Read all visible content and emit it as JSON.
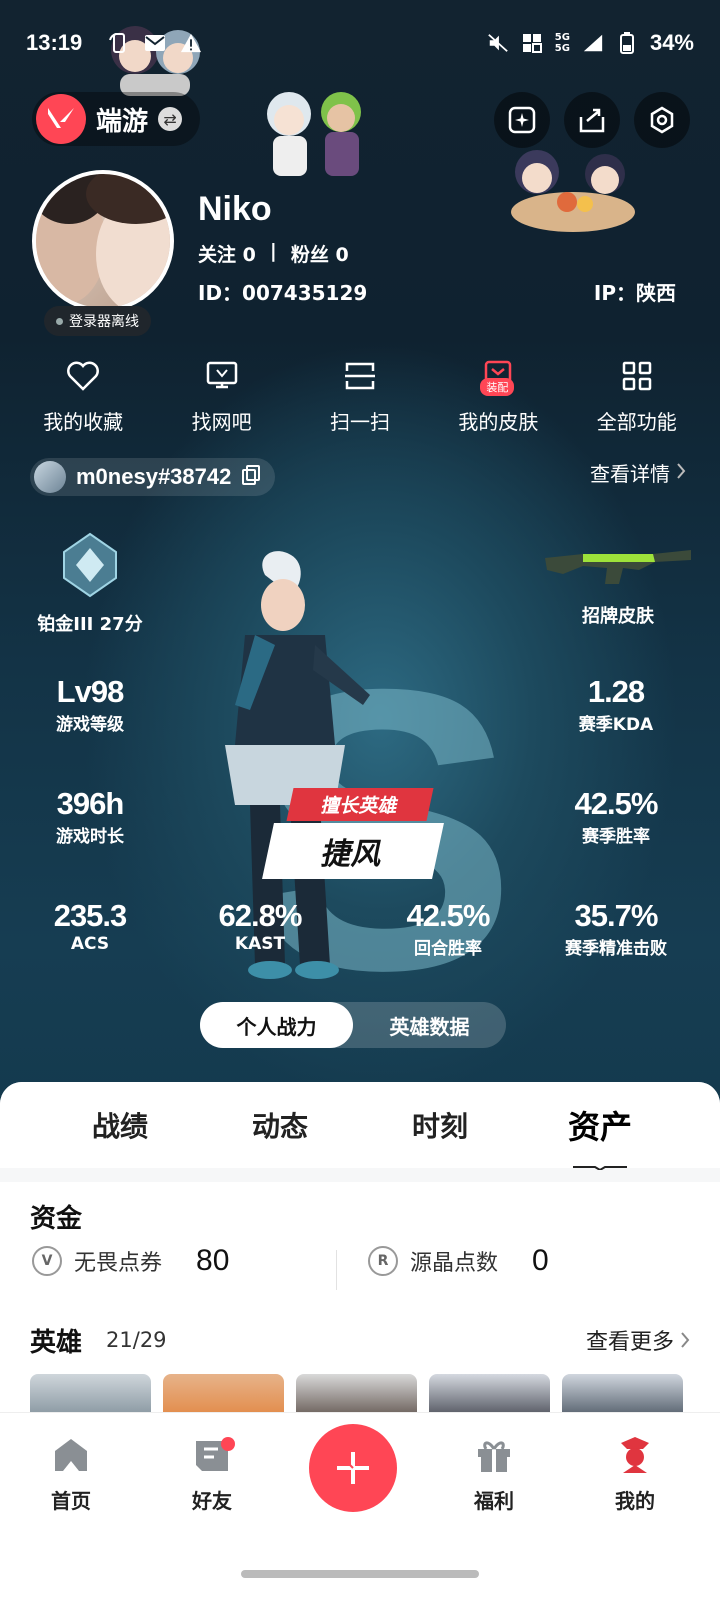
{
  "status_bar": {
    "time": "13:19",
    "network_top": "5G",
    "network_bottom": "5G",
    "battery": "34%"
  },
  "header": {
    "game_name": "端游",
    "icons": [
      "add-post-icon",
      "share-icon",
      "settings-icon"
    ]
  },
  "profile": {
    "nickname": "Niko",
    "follow_label": "关注",
    "follow_count": "0",
    "separator": "|",
    "fans_label": "粉丝",
    "fans_count": "0",
    "id_text": "ID：007435129",
    "ip_text": "IP：陕西",
    "status": "登录器离线"
  },
  "quick_functions": [
    {
      "label": "我的收藏",
      "icon": "heart-icon"
    },
    {
      "label": "找网吧",
      "icon": "monitor-icon"
    },
    {
      "label": "扫一扫",
      "icon": "scan-icon"
    },
    {
      "label": "我的皮肤",
      "icon": "skin-icon",
      "badge": "装配"
    },
    {
      "label": "全部功能",
      "icon": "grid-icon"
    }
  ],
  "account": {
    "name": "m0nesy#38742",
    "details_link": "查看详情"
  },
  "stats": {
    "rank": {
      "value": "铂金III 27分"
    },
    "showcase_skin": {
      "label": "招牌皮肤"
    },
    "level": {
      "value": "Lv98",
      "label": "游戏等级"
    },
    "kda": {
      "value": "1.28",
      "label": "赛季KDA"
    },
    "playtime": {
      "value": "396h",
      "label": "游戏时长"
    },
    "season_winrate": {
      "value": "42.5%",
      "label": "赛季胜率"
    },
    "acs": {
      "value": "235.3",
      "label": "ACS"
    },
    "kast": {
      "value": "62.8%",
      "label": "KAST"
    },
    "round_winrate": {
      "value": "42.5%",
      "label": "回合胜率"
    },
    "precise_kills": {
      "value": "35.7%",
      "label": "赛季精准击败"
    }
  },
  "best_hero": {
    "tag": "擅长英雄",
    "name": "捷风"
  },
  "segment": {
    "options": [
      "个人战力",
      "英雄数据"
    ],
    "selected": "个人战力"
  },
  "tabs": {
    "items": [
      "战绩",
      "动态",
      "时刻",
      "资产"
    ],
    "active": "资产"
  },
  "funds": {
    "title": "资金",
    "items": [
      {
        "name": "无畏点券",
        "value": "80",
        "icon": "valorant-points-icon"
      },
      {
        "name": "源晶点数",
        "value": "0",
        "icon": "radianite-icon"
      }
    ]
  },
  "heroes": {
    "title": "英雄",
    "owned": "21",
    "total": "29",
    "more_link": "查看更多"
  },
  "bottom_nav": {
    "items": [
      "首页",
      "好友",
      "福利",
      "我的"
    ],
    "active": "我的"
  },
  "colors": {
    "accent": "#ff4655",
    "hero_bg": "#133346",
    "sheet_bg": "#f6f7f8"
  }
}
